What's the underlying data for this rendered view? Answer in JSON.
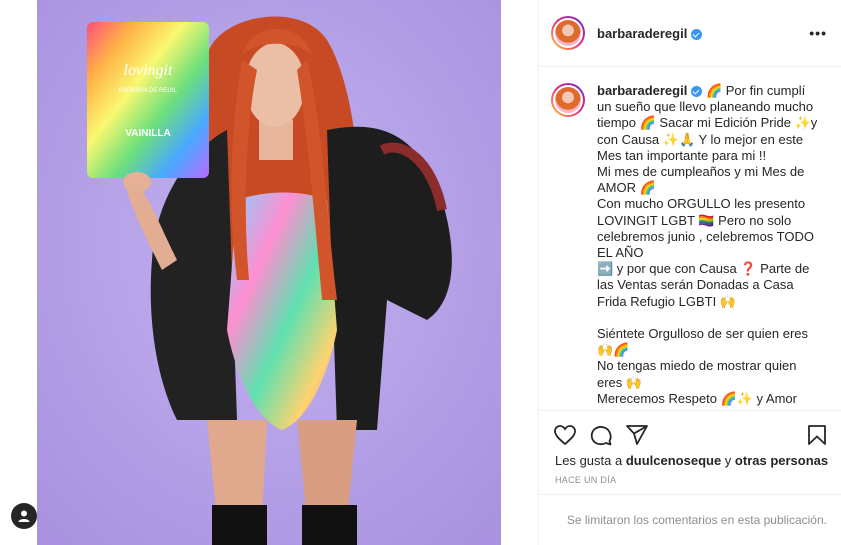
{
  "post": {
    "username": "barbaraderegil",
    "verified": true,
    "more_icon": "more-icon",
    "caption_username": "barbaraderegil",
    "caption": " 🌈 Por fin cumplí un sueño que llevo planeando mucho tiempo 🌈 Sacar mi Edición Pride ✨y con Causa ✨🙏 Y lo mejor en este Mes tan importante para mi !!\nMi mes de cumpleaños y mi Mes de AMOR 🌈\nCon mucho ORGULLO les presento LOVINGIT LGBT 🏳️‍🌈 Pero no solo celebremos junio , celebremos TODO EL AÑO\n➡️ y por que con Causa ❓ Parte de las Ventas serán Donadas a Casa Frida Refugio LGBTI 🙌\n\nSiéntete Orgulloso de ser quien eres 🙌🌈\nNo tengas miedo de mostrar quien eres 🙌\nMerecemos Respeto 🌈✨ y Amor",
    "likes_prefix": "Les gusta a ",
    "likes_user": "duulcenoseque",
    "likes_middle": " y ",
    "likes_others": "otras personas",
    "time_ago": "HACE UN DÍA",
    "comments_disabled": "Se limitaron los comentarios en esta publicación."
  },
  "product": {
    "brand": "lovingit",
    "line": "BARBARA DE REGIL",
    "flavor": "VAINILLA"
  },
  "colors": {
    "background_purple": "#b5a2e6",
    "verified_blue": "#3897f0",
    "hair": "#d2542a"
  },
  "icons": [
    "heart-icon",
    "comment-icon",
    "share-icon",
    "bookmark-icon",
    "user-icon"
  ]
}
